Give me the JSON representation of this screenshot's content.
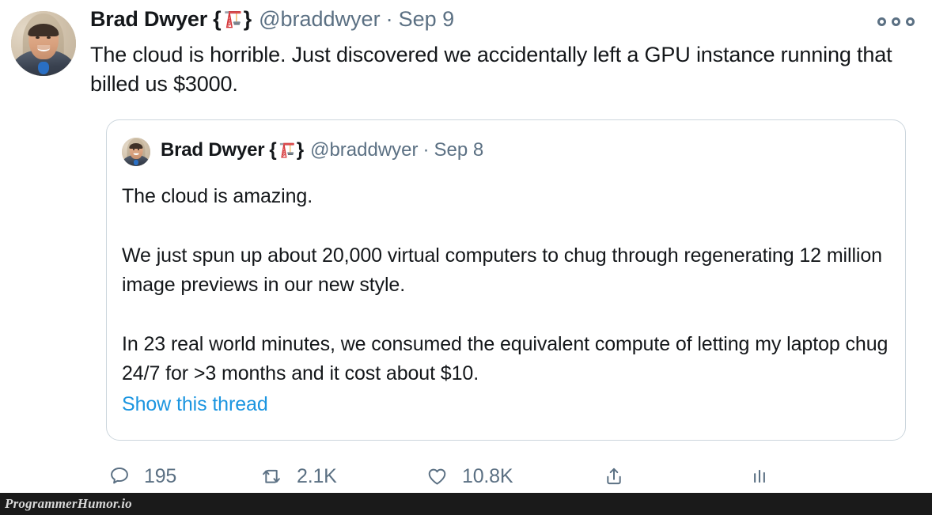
{
  "tweet": {
    "display_name": "Brad Dwyer",
    "name_emoji": "{🏗}",
    "emoji_name": "construction-crane-emoji",
    "handle": "@braddwyer",
    "separator": "·",
    "date": "Sep 9",
    "text": "The cloud is horrible. Just discovered we accidentally left a GPU instance running that billed us $3000.",
    "more_menu_label": "More"
  },
  "quoted_tweet": {
    "display_name": "Brad Dwyer",
    "name_emoji": "{🏗}",
    "handle": "@braddwyer",
    "separator": "·",
    "date": "Sep 8",
    "paragraphs": [
      "The cloud is amazing.",
      "We just spun up about 20,000 virtual computers to chug through regenerating 12 million image previews in our new style.",
      "In 23 real world minutes, we consumed the equivalent compute of letting my laptop chug 24/7 for >3 months and it cost about $10."
    ],
    "show_thread_label": "Show this thread"
  },
  "actions": {
    "reply": {
      "icon": "reply-icon",
      "count": "195"
    },
    "retweet": {
      "icon": "retweet-icon",
      "count": "2.1K"
    },
    "like": {
      "icon": "heart-icon",
      "count": "10.8K"
    },
    "share": {
      "icon": "share-icon",
      "count": ""
    },
    "analytics": {
      "icon": "analytics-icon",
      "count": ""
    }
  },
  "watermark": {
    "label": "ProgrammerHumor.io"
  },
  "colors": {
    "text": "#14171a",
    "muted": "#5b7083",
    "link": "#1b95e0",
    "card_border": "#ccd6dd",
    "background": "#ffffff",
    "watermark_bar": "#1a1a1a"
  }
}
